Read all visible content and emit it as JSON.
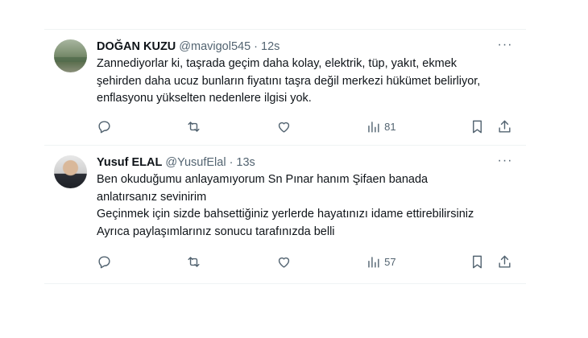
{
  "tweets": [
    {
      "name": "DOĞAN KUZU",
      "handle": "@mavigol545",
      "separator": "·",
      "time": "12s",
      "text": "Zannediyorlar ki, taşrada geçim daha kolay, elektrik, tüp, yakıt, ekmek\nşehirden daha ucuz bunların fiyatını taşra değil merkezi hükümet belirliyor,\nenflasyonu yükselten nedenlere ilgisi yok.",
      "views": "81",
      "more": "···",
      "avatar_icon": "landscape-avatar"
    },
    {
      "name": "Yusuf ELAL",
      "handle": "@YusufElal",
      "separator": "·",
      "time": "13s",
      "text": "Ben okuduğumu anlayamıyorum Sn Pınar hanım Şifaen banada\nanlatırsanız sevinirim\nGeçinmek için sizde bahsettiğiniz yerlerde hayatınızı idame ettirebilirsiniz\nAyrıca paylaşımlarınız sonucu tarafınızda belli",
      "views": "57",
      "more": "···",
      "avatar_icon": "person-avatar"
    }
  ],
  "icons": {
    "reply": "reply-icon",
    "retweet": "retweet-icon",
    "like": "heart-icon",
    "views": "views-chart-icon",
    "bookmark": "bookmark-icon",
    "share": "share-icon"
  }
}
